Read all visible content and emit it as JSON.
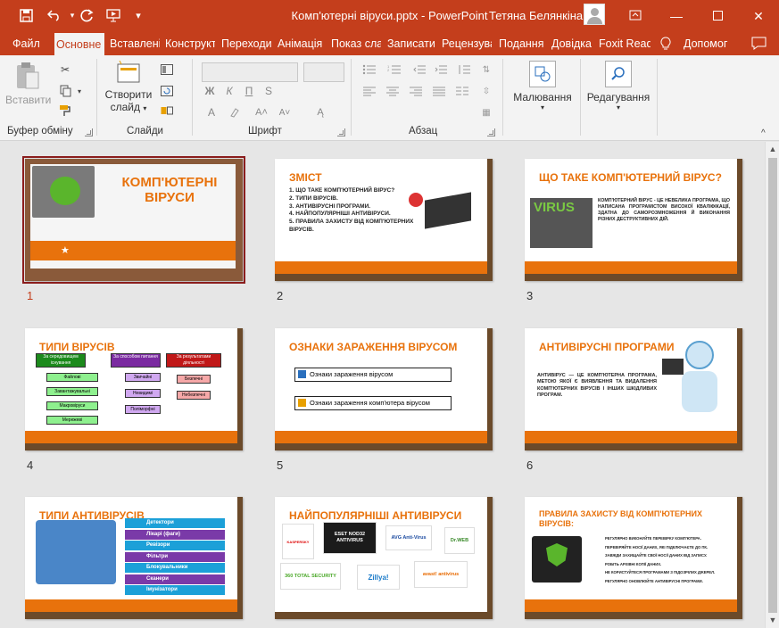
{
  "window": {
    "title": "Комп'ютерні віруси.pptx  -  PowerPoint",
    "user": "Тетяна Белянкіна"
  },
  "tabs": [
    "Файл",
    "Основне",
    "Вставлені",
    "Конструкт",
    "Переходи",
    "Анімація",
    "Показ сла",
    "Записати",
    "Рецензува",
    "Подання",
    "Довідка",
    "Foxit Read",
    "Допомог"
  ],
  "ribbon": {
    "paste": "Вставити",
    "new_slide_1": "Створити",
    "new_slide_2": "слайд",
    "drawing": "Малювання",
    "editing_1": "Редагування",
    "groups": [
      "Буфер обміну",
      "Слайди",
      "Шрифт",
      "Абзац"
    ],
    "font_bold": "Ж",
    "font_italic": "К",
    "font_underline": "П",
    "font_strike": "S",
    "font_a": "A"
  },
  "slides": [
    {
      "num": "1",
      "title_1": "КОМП'ЮТЕРНІ",
      "title_2": "ВІРУСИ"
    },
    {
      "num": "2",
      "title": "ЗМІСТ",
      "items": [
        "1. ЩО ТАКЕ КОМП'ЮТЕРНИЙ ВІРУС?",
        "2. ТИПИ ВІРУСІВ.",
        "3. АНТИВІРУСНІ ПРОГРАМИ.",
        "4. НАЙПОПУЛЯРНІШІ АНТИВІРУСИ.",
        "5. ПРАВИЛА ЗАХИСТУ ВІД КОМП'ЮТЕРНИХ ВІРУСІВ."
      ]
    },
    {
      "num": "3",
      "title": "ЩО ТАКЕ КОМП'ЮТЕРНИЙ ВІРУС?",
      "word": "VIRUS",
      "text": "КОМП'ЮТЕРНИЙ ВІРУС - ЦЕ НЕВЕЛИКА ПРОГРАМА, ЩО НАПИСАНА ПРОГРАМІСТОМ ВИСОКОЇ КВАЛІФІКАЦІЇ, ЗДАТНА ДО САМОРОЗМНОЖЕННЯ Й ВИКОНАННЯ РІЗНИХ ДЕСТРУКТИВНИХ ДІЙ."
    },
    {
      "num": "4",
      "title": "ТИПИ ВІРУСІВ",
      "heads": [
        "За середовищем існування",
        "За способом питання",
        "За результатами діяльності"
      ],
      "col1": [
        "Файлові",
        "Завантажувальні",
        "Макровіруси",
        "Мережеві"
      ],
      "col2": [
        "Звичайні",
        "Невидимі",
        "Поліморфні"
      ],
      "col3": [
        "Безпечні",
        "Небезпечні"
      ]
    },
    {
      "num": "5",
      "title": "ОЗНАКИ ЗАРАЖЕННЯ ВІРУСОМ",
      "links": [
        "Ознаки зараження вірусом",
        "Ознаки зараження комп'ютера вірусом"
      ]
    },
    {
      "num": "6",
      "title": "АНТИВІРУСНІ ПРОГРАМИ",
      "text": "АНТИВІРУС — ЦЕ КОМП'ЮТЕРНА ПРОГРАМА, МЕТОЮ ЯКОЇ Є ВИЯВЛЕННЯ ТА ВИДАЛЕННЯ КОМП'ЮТЕРНИХ ВІРУСІВ І ІНШИХ ШКІДЛИВИХ ПРОГРАМ."
    },
    {
      "num": "7",
      "title": "ТИПИ АНТИВІРУСІВ",
      "items": [
        "Детектори",
        "Лікарі (фаги)",
        "Ревізори",
        "Фільтри",
        "Блокувальники",
        "Сканери",
        "Імунізатори"
      ]
    },
    {
      "num": "8",
      "title": "НАЙПОПУЛЯРНІШІ АНТИВІРУСИ",
      "logos": [
        "KASPERSKY",
        "ESET NOD32 ANTIVIRUS",
        "AVG Anti-Virus",
        "Dr.WEB",
        "360 TOTAL SECURITY",
        "Zillya!",
        "avast! antivirus"
      ]
    },
    {
      "num": "9",
      "title_1": "ПРАВИЛА ЗАХИСТУ ВІД КОМП'ЮТЕРНИХ",
      "title_2": "ВІРУСІВ:",
      "items": [
        "РЕГУЛЯРНО ВИКОНУЙТЕ ПЕРЕВІРКУ КОМП'ЮТЕРА.",
        "ПЕРЕВІРЯЙТЕ НОСІЇ ДАНИХ, ЯКІ ПІДКЛЮЧАЄТЕ ДО ПК.",
        "ЗАВЖДИ ЗАХИЩАЙТЕ СВОЇ НОСІЇ ДАНИХ ВІД ЗАПИСУ.",
        "РОБІТЬ АРХІВНІ КОПІЇ ДАНИХ.",
        "НЕ КОРИСТУЙТЕСЯ ПРОГРАМАМИ З ПІДОЗРІЛИХ ДЖЕРЕЛ.",
        "РЕГУЛЯРНО ОНОВЛЮЙТЕ АНТИВІРУСНІ ПРОГРАМИ."
      ]
    }
  ],
  "colors": {
    "accent": "#c43e1c",
    "orange": "#e8720c",
    "selected": "#8b1d1d"
  }
}
